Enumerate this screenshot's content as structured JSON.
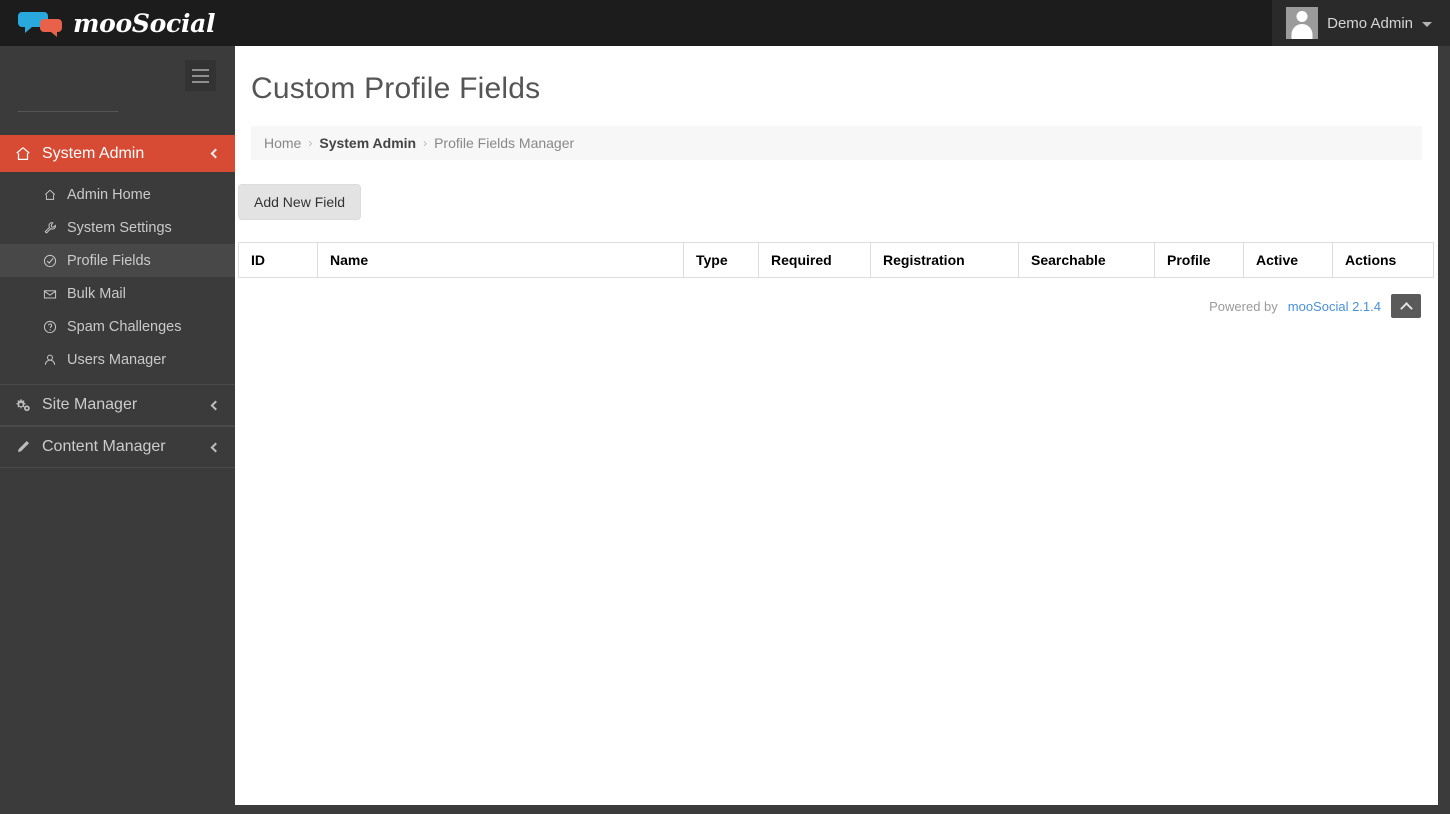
{
  "topbar": {
    "brand_name": "mooSocial",
    "brand_logo_icon": "speech-bubbles-icon",
    "user_name": "Demo Admin",
    "avatar_icon": "user-avatar-placeholder-icon",
    "caret_icon": "chevron-down-icon"
  },
  "sidebar": {
    "hamburger_icon": "hamburger-menu-icon",
    "groups": [
      {
        "label": "System Admin",
        "icon": "home-icon",
        "active": true,
        "chevron_icon": "chevron-left-icon",
        "items": [
          {
            "label": "Admin Home",
            "icon": "home-icon",
            "active": false
          },
          {
            "label": "System Settings",
            "icon": "wrench-icon",
            "active": false
          },
          {
            "label": "Profile Fields",
            "icon": "check-circle-icon",
            "active": true
          },
          {
            "label": "Bulk Mail",
            "icon": "envelope-icon",
            "active": false
          },
          {
            "label": "Spam Challenges",
            "icon": "question-circle-icon",
            "active": false
          },
          {
            "label": "Users Manager",
            "icon": "user-icon",
            "active": false
          }
        ]
      },
      {
        "label": "Site Manager",
        "icon": "gears-icon",
        "active": false,
        "chevron_icon": "chevron-left-icon",
        "items": []
      },
      {
        "label": "Content Manager",
        "icon": "pencil-icon",
        "active": false,
        "chevron_icon": "chevron-left-icon",
        "items": []
      }
    ]
  },
  "main": {
    "page_title": "Custom Profile Fields",
    "breadcrumb": {
      "home": "Home",
      "sep1": "›",
      "section": "System Admin",
      "sep2": "›",
      "current": "Profile Fields Manager"
    },
    "add_button_label": "Add New Field",
    "table": {
      "columns": [
        "ID",
        "Name",
        "Type",
        "Required",
        "Registration",
        "Searchable",
        "Profile",
        "Active",
        "Actions"
      ],
      "rows": []
    }
  },
  "footer": {
    "powered_by": "Powered by",
    "product_link": "mooSocial 2.1.4",
    "to_top_icon": "chevron-up-icon"
  },
  "colors": {
    "accent": "#d74a33",
    "sidebar_bg": "#3b3b3b",
    "topbar_bg": "#1c1c1c",
    "link": "#4a90d9"
  }
}
